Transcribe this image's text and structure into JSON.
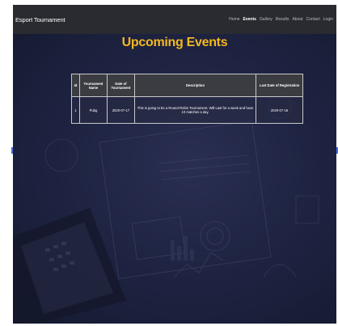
{
  "navbar": {
    "brand": "Esport Tournament",
    "links": [
      {
        "label": "Home"
      },
      {
        "label": "Events"
      },
      {
        "label": "Gallery"
      },
      {
        "label": "Results"
      },
      {
        "label": "About"
      },
      {
        "label": "Contact"
      },
      {
        "label": "Login"
      }
    ],
    "active": "Events"
  },
  "main": {
    "title": "Upcoming Events",
    "table": {
      "headers": [
        "Id",
        "Tournament Name",
        "Date of Tournament",
        "Description",
        "Last Date of Registration"
      ],
      "rows": [
        [
          "1",
          "Pubg",
          "2020-07-17",
          "This is going to be a Round-Robin Tournament. Will Last for a week and have 10 matches a day.",
          "2020-07-16"
        ]
      ]
    }
  },
  "colors": {
    "title": "#f5b81f",
    "navbar_bg": "#2a2b31",
    "background": "#1b2038"
  },
  "icons": [
    "carousel-prev-icon",
    "carousel-next-icon"
  ]
}
